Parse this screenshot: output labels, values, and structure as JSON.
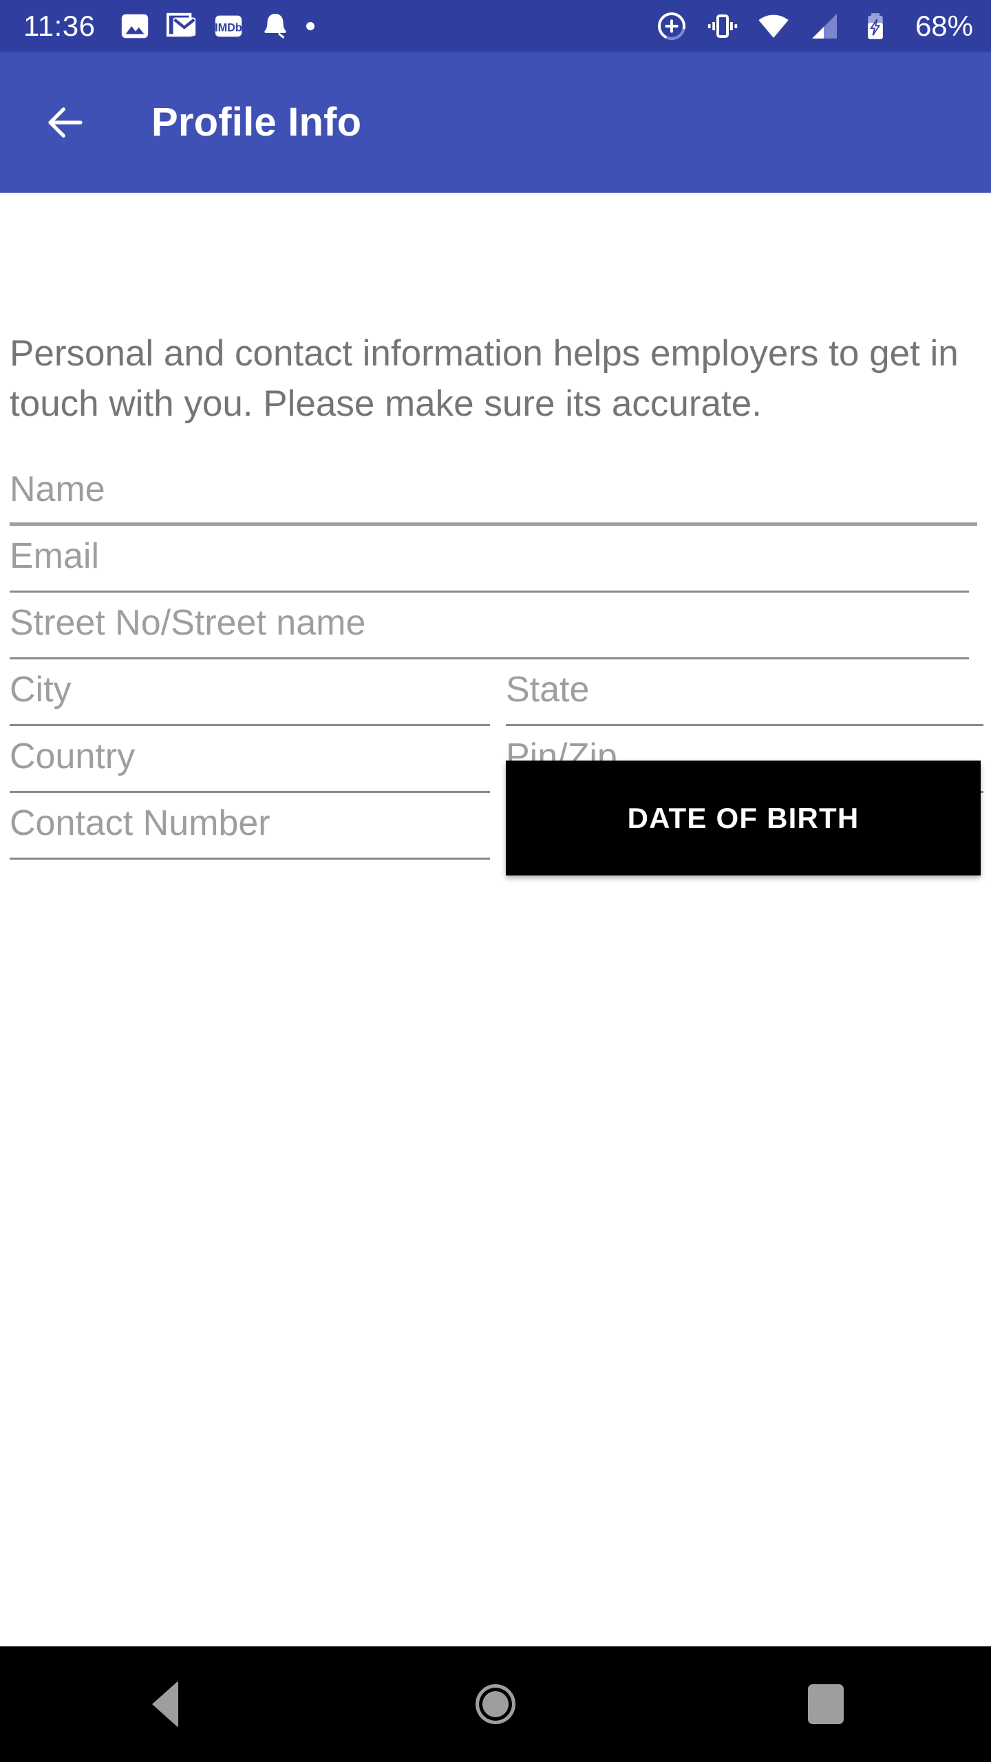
{
  "status_bar": {
    "time": "11:36",
    "battery_percent": "68%",
    "left_icons": [
      "photos-icon",
      "gmail-icon",
      "imdb-icon",
      "bell-icon",
      "dot-icon"
    ],
    "right_icons": [
      "dnd-add-icon",
      "vibrate-icon",
      "wifi-icon",
      "cellular-signal-icon",
      "battery-charging-icon"
    ],
    "background_color": "#303f9f",
    "foreground_color": "#ffffff"
  },
  "app_bar": {
    "back_icon": "back-arrow-icon",
    "title": "Profile Info",
    "background_color": "#3f51b5",
    "title_color": "#ffffff"
  },
  "main": {
    "intro_text": "Personal and contact information helps employers to get in touch with you. Please make sure its accurate.",
    "intro_color": "#757575",
    "fields": [
      {
        "key": "name",
        "label": "Name",
        "value": "",
        "focused": true
      },
      {
        "key": "email",
        "label": "Email",
        "value": "",
        "focused": false
      },
      {
        "key": "street",
        "label": "Street No/Street name",
        "value": "",
        "focused": false
      },
      {
        "key": "city",
        "label": "City",
        "value": "",
        "focused": false
      },
      {
        "key": "state",
        "label": "State",
        "value": "",
        "focused": false
      },
      {
        "key": "country",
        "label": "Country",
        "value": "",
        "focused": false
      },
      {
        "key": "pin",
        "label": "Pin/Zip",
        "value": "",
        "focused": false
      },
      {
        "key": "contact",
        "label": "Contact Number",
        "value": "",
        "focused": false
      }
    ],
    "date_of_birth_button": {
      "label": "DATE OF BIRTH",
      "background_color": "#000000",
      "text_color": "#ffffff"
    }
  },
  "nav_bar": {
    "background_color": "#000000",
    "icon_color": "#9e9e9e",
    "buttons": [
      "back-triangle-icon",
      "home-circle-icon",
      "recents-square-icon"
    ]
  }
}
